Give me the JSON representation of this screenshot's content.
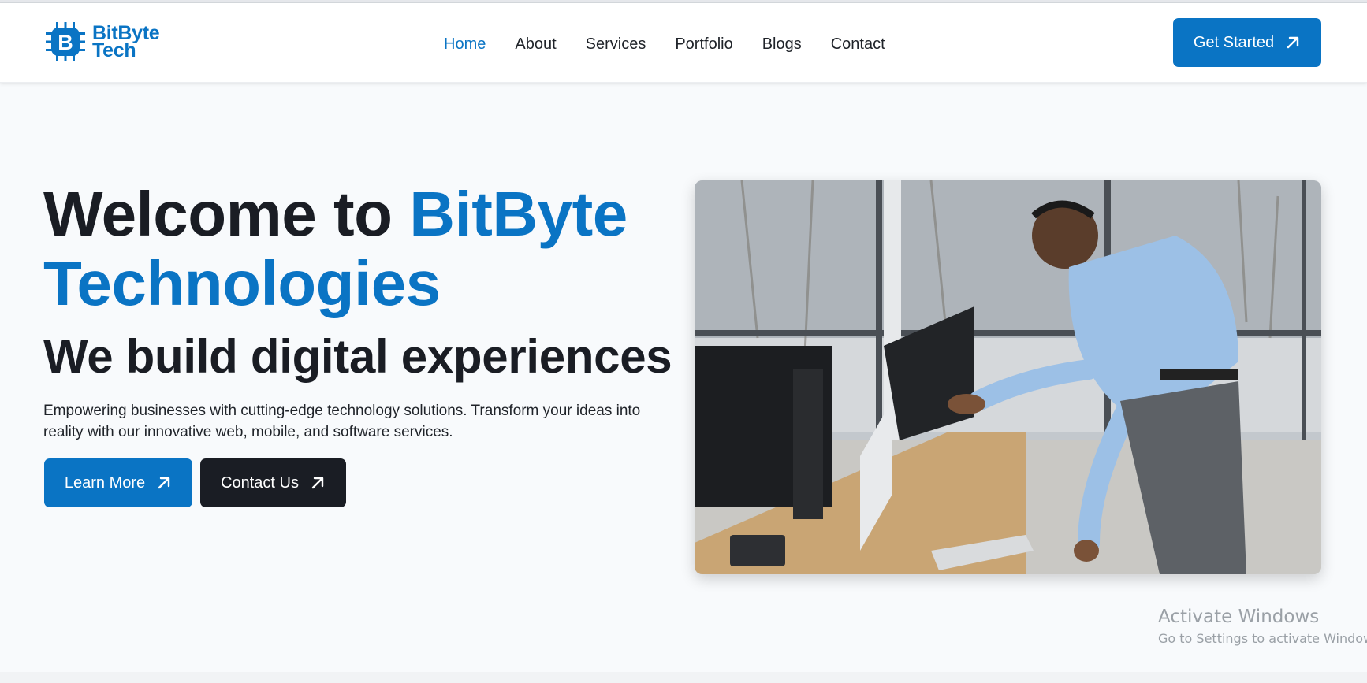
{
  "brand": {
    "name_line1": "BitByte",
    "name_line2": "Tech",
    "color": "#0a74c4"
  },
  "nav": {
    "items": [
      {
        "label": "Home",
        "active": true
      },
      {
        "label": "About",
        "active": false
      },
      {
        "label": "Services",
        "active": false
      },
      {
        "label": "Portfolio",
        "active": false
      },
      {
        "label": "Blogs",
        "active": false
      },
      {
        "label": "Contact",
        "active": false
      }
    ],
    "cta_label": "Get Started",
    "cta_icon": "arrow-up-right-icon"
  },
  "hero": {
    "title_prefix": "Welcome to ",
    "title_accent_line1": "BitByte",
    "title_accent_line2": "Technologies",
    "subtitle": "We build digital experiences",
    "description": "Empowering businesses with cutting-edge technology solutions. Transform your ideas into reality with our innovative web, mobile, and software services.",
    "learn_more_label": "Learn More",
    "contact_us_label": "Contact Us",
    "image_icon": "office-worker-photo"
  },
  "watermark": {
    "title": "Activate Windows",
    "subtitle": "Go to Settings to activate Windows."
  },
  "colors": {
    "primary": "#0a74c4",
    "dark": "#1a1d24",
    "background": "#f8fafc"
  }
}
